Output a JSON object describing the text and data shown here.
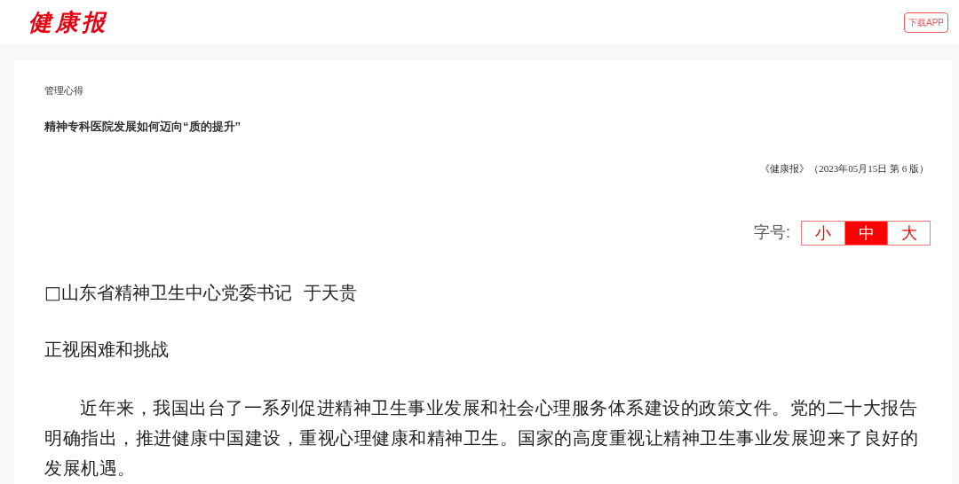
{
  "header": {
    "logo": "健康报",
    "download_button": "下载APP"
  },
  "article": {
    "column": "管理心得",
    "title": "精神专科医院发展如何迈向“质的提升”",
    "source": "《健康报》（2023年05月15日 第 6 版）",
    "font_size": {
      "label": "字号:",
      "options": [
        {
          "label": "小",
          "selected": false
        },
        {
          "label": "中",
          "selected": true
        },
        {
          "label": "大",
          "selected": false
        }
      ]
    },
    "body": [
      {
        "kind": "byline",
        "text": "□山东省精神卫生中心党委书记  于天贵"
      },
      {
        "kind": "subheading",
        "text": "正视困难和挑战"
      },
      {
        "kind": "paragraph",
        "text": "近年来，我国出台了一系列促进精神卫生事业发展和社会心理服务体系建设的政策文件。党的二十大报告明确指出，推进健康中国建设，重视心理健康和精神卫生。国家的高度重视让精神卫生事业发展迎来了良好的发展机遇。"
      }
    ]
  }
}
